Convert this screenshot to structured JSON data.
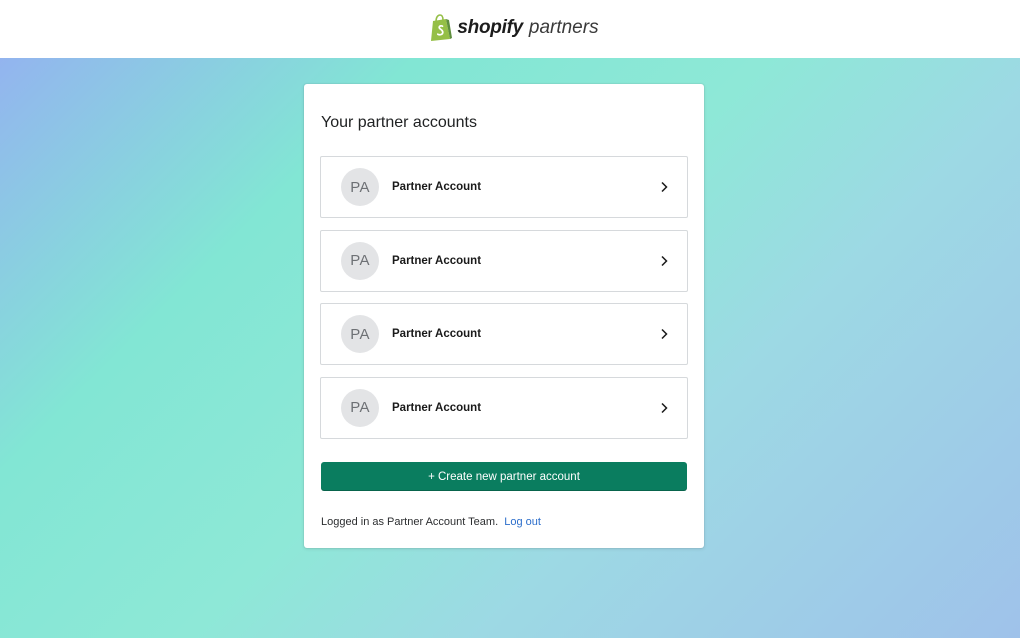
{
  "header": {
    "logo_word": "shopify",
    "logo_sub": "partners",
    "logo_icon": "shopify-bag-icon",
    "logo_color": "#95bf47"
  },
  "card": {
    "title": "Your partner accounts",
    "accounts": [
      {
        "initials": "PA",
        "name": "Partner Account",
        "icon": "chevron-right-icon"
      },
      {
        "initials": "PA",
        "name": "Partner Account",
        "icon": "chevron-right-icon"
      },
      {
        "initials": "PA",
        "name": "Partner Account",
        "icon": "chevron-right-icon"
      },
      {
        "initials": "PA",
        "name": "Partner Account",
        "icon": "chevron-right-icon"
      }
    ],
    "create_button_label": "+ Create new partner account",
    "create_button_color": "#0a7d5f",
    "footer_text": "Logged in as Partner Account Team.",
    "logout_label": "Log out",
    "link_color": "#2c6ecb"
  }
}
